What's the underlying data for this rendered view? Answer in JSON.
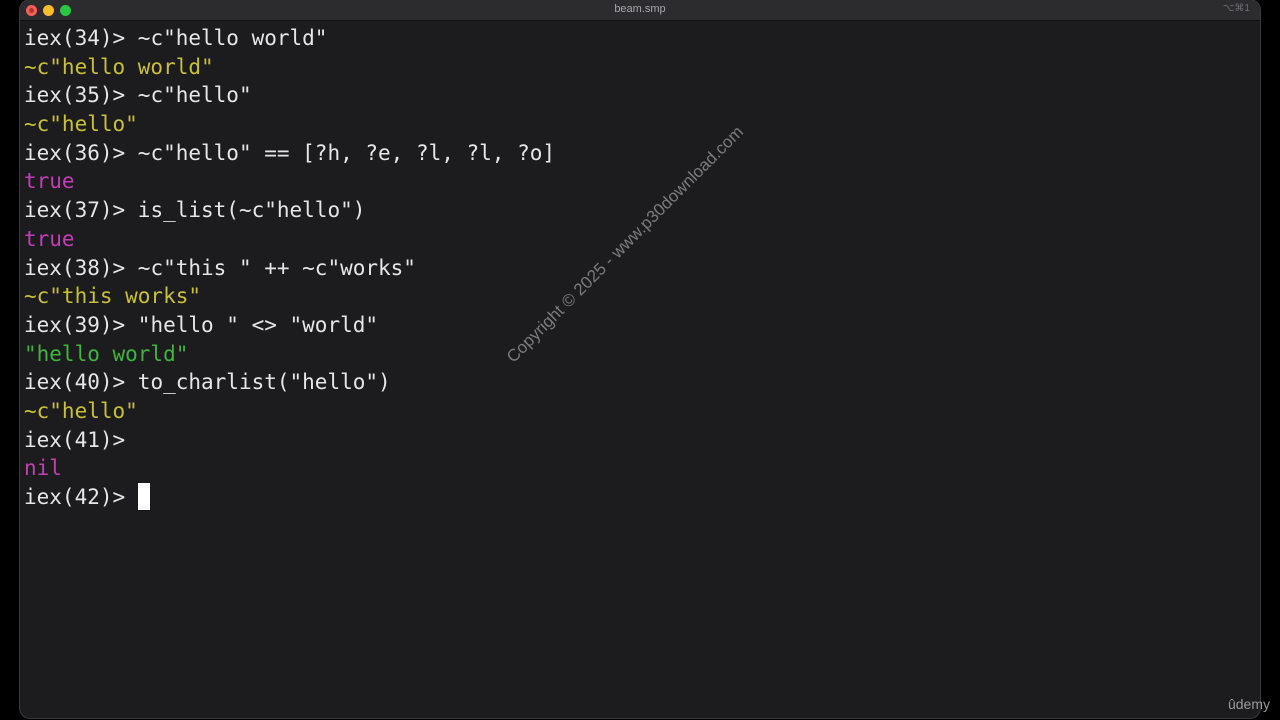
{
  "window": {
    "title": "beam.smp",
    "shortcut": "⌥⌘1"
  },
  "terminal": {
    "lines": [
      {
        "prompt": "iex(34)> ",
        "input": "~c\"hello world\""
      },
      {
        "output": "~c\"hello world\"",
        "kind": "charlist"
      },
      {
        "prompt": "iex(35)> ",
        "input": "~c\"hello\""
      },
      {
        "output": "~c\"hello\"",
        "kind": "charlist"
      },
      {
        "prompt": "iex(36)> ",
        "input": "~c\"hello\" == [?h, ?e, ?l, ?l, ?o]"
      },
      {
        "output": "true",
        "kind": "bool"
      },
      {
        "prompt": "iex(37)> ",
        "input": "is_list(~c\"hello\")"
      },
      {
        "output": "true",
        "kind": "bool"
      },
      {
        "prompt": "iex(38)> ",
        "input": "~c\"this \" ++ ~c\"works\""
      },
      {
        "output": "~c\"this works\"",
        "kind": "charlist"
      },
      {
        "prompt": "iex(39)> ",
        "input": "\"hello \" <> \"world\""
      },
      {
        "output": "\"hello world\"",
        "kind": "string"
      },
      {
        "prompt": "iex(40)> ",
        "input": "to_charlist(\"hello\")"
      },
      {
        "output": "~c\"hello\"",
        "kind": "charlist"
      },
      {
        "prompt": "iex(41)> ",
        "input": ""
      },
      {
        "output": "nil",
        "kind": "bool"
      },
      {
        "prompt": "iex(42)> ",
        "input": "",
        "cursor": true
      }
    ]
  },
  "watermark": "Copyright © 2025 - www.p30download.com",
  "brand": "ûdemy",
  "colors": {
    "charlist": "#c9c039",
    "bool": "#c13fb2",
    "string": "#3fb43f"
  }
}
